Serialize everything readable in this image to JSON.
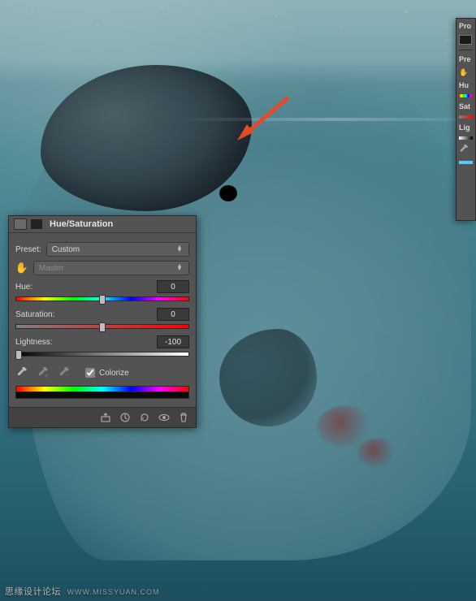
{
  "panel": {
    "title": "Hue/Saturation",
    "preset_label": "Preset:",
    "preset_value": "Custom",
    "channel_value": "Master",
    "hue_label": "Hue:",
    "hue_value": "0",
    "sat_label": "Saturation:",
    "sat_value": "0",
    "light_label": "Lightness:",
    "light_value": "-100",
    "colorize_label": "Colorize"
  },
  "side": {
    "group1": "Pro",
    "group2": "Pre",
    "hue": "Hu",
    "sat": "Sat",
    "light": "Lig"
  },
  "watermark": {
    "cn": "思缘设计论坛",
    "en": "WWW.MISSYUAN.COM"
  },
  "annotation": {
    "arrow_color": "#e44a2a"
  }
}
